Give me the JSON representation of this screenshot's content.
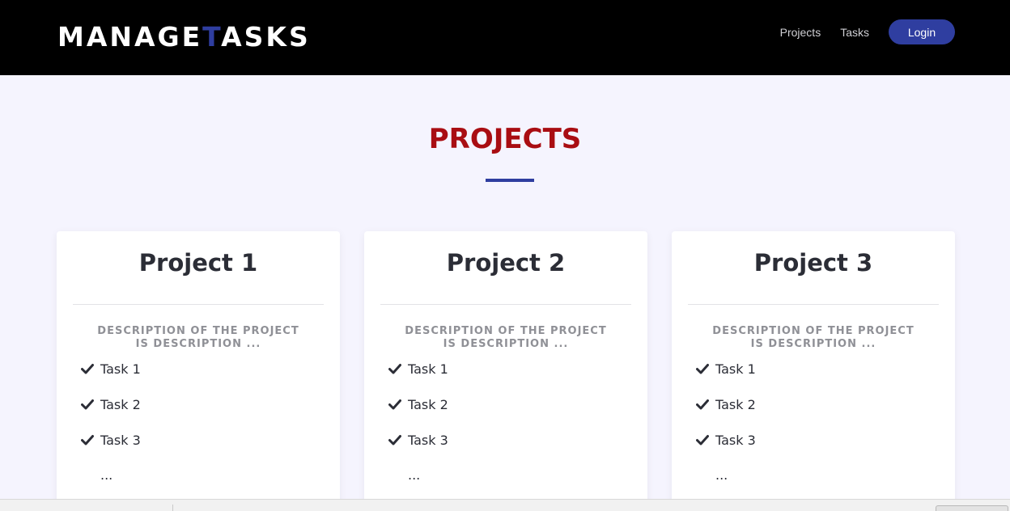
{
  "header": {
    "logo_part1": "MANAGE",
    "logo_accent": "T",
    "logo_part2": "ASKS",
    "nav": {
      "projects": "Projects",
      "tasks": "Tasks",
      "login": "Login"
    }
  },
  "section": {
    "title": "PROJECTS"
  },
  "projects": [
    {
      "title": "Project 1",
      "description": "DESCRIPTION OF THE PROJECT IS DESCRIPTION ...",
      "tasks": [
        "Task 1",
        "Task 2",
        "Task 3"
      ],
      "more": "..."
    },
    {
      "title": "Project 2",
      "description": "DESCRIPTION OF THE PROJECT IS DESCRIPTION ...",
      "tasks": [
        "Task 1",
        "Task 2",
        "Task 3"
      ],
      "more": "..."
    },
    {
      "title": "Project 3",
      "description": "DESCRIPTION OF THE PROJECT IS DESCRIPTION ...",
      "tasks": [
        "Task 1",
        "Task 2",
        "Task 3"
      ],
      "more": "..."
    }
  ],
  "colors": {
    "header_bg": "#000000",
    "accent": "#2f3ea0",
    "title_red": "#a90d12",
    "page_bg": "#f5f4fe"
  },
  "icons": {
    "task": "check-icon"
  }
}
